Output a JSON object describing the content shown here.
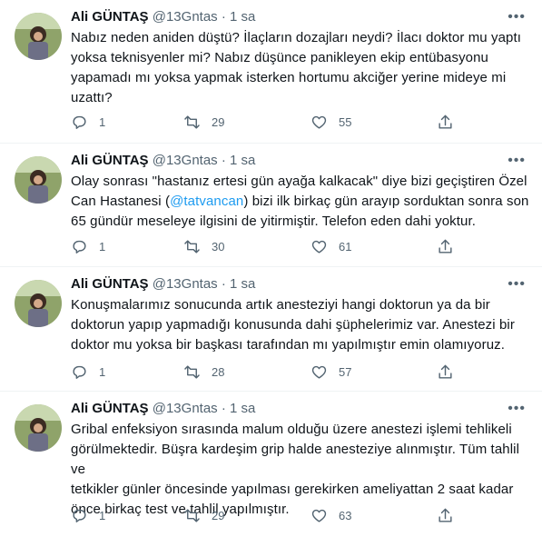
{
  "tweets": [
    {
      "author": "Ali GÜNTAŞ",
      "handle": "@13Gntas",
      "sep": "·",
      "time": "1 sa",
      "lines": [
        "Nabız neden aniden düştü? İlaçların dozajları neydi? İlacı doktor mu yaptı",
        "yoksa teknisyenler mi? Nabız düşünce panikleyen ekip entübasyonu",
        "yapamadı mı yoksa yapmak isterken hortumu akciğer yerine mideye mi",
        "uzattı?"
      ],
      "replies": "1",
      "retweets": "29",
      "likes": "55"
    },
    {
      "author": "Ali GÜNTAŞ",
      "handle": "@13Gntas",
      "sep": "·",
      "time": "1 sa",
      "line1": "Olay sonrası \"hastanız ertesi gün ayağa kalkacak\" diye bizi geçiştiren Özel",
      "line2_pre": "Can Hastanesi (",
      "mention": "@tatvancan",
      "line2_post": ") bizi ilk birkaç gün arayıp sorduktan sonra son",
      "line3": "65 gündür meseleye ilgisini de yitirmiştir. Telefon eden dahi yoktur.",
      "replies": "1",
      "retweets": "30",
      "likes": "61"
    },
    {
      "author": "Ali GÜNTAŞ",
      "handle": "@13Gntas",
      "sep": "·",
      "time": "1 sa",
      "lines": [
        "Konuşmalarımız sonucunda artık anesteziyi hangi doktorun ya da bir",
        "doktorun yapıp yapmadığı konusunda dahi şüphelerimiz var. Anestezi bir",
        "doktor mu yoksa bir başkası tarafından mı yapılmıştır emin olamıyoruz."
      ],
      "replies": "1",
      "retweets": "28",
      "likes": "57"
    },
    {
      "author": "Ali GÜNTAŞ",
      "handle": "@13Gntas",
      "sep": "·",
      "time": "1 sa",
      "lines": [
        "Gribal enfeksiyon sırasında malum olduğu üzere anestezi işlemi tehlikeli",
        "görülmektedir. Büşra kardeşim grip halde anesteziye alınmıştır. Tüm tahlil ve",
        "tetkikler günler öncesinde yapılması gerekirken ameliyattan 2 saat kadar",
        "önce birkaç test ve tahlil yapılmıştır."
      ],
      "replies": "1",
      "retweets": "29",
      "likes": "63"
    }
  ],
  "icons": {
    "reply": "reply-icon",
    "retweet": "retweet-icon",
    "like": "heart-icon",
    "share": "share-icon",
    "more": "more-icon"
  },
  "colors": {
    "text": "#0f1419",
    "muted": "#536471",
    "link": "#1d9bf0",
    "divider": "#eff3f4"
  }
}
